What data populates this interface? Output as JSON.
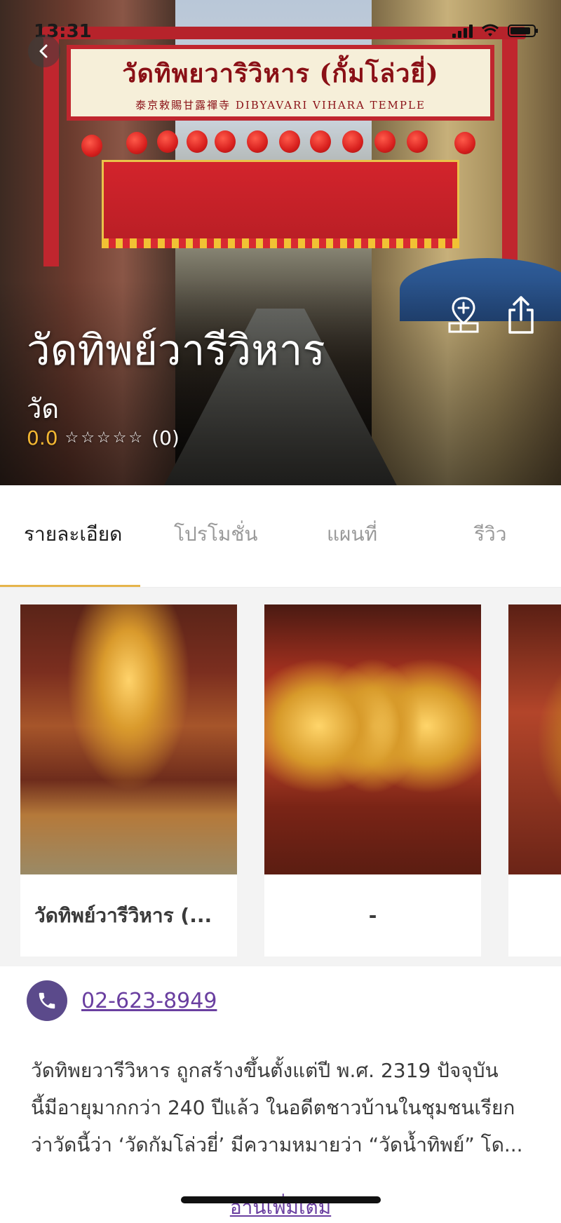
{
  "status_bar": {
    "time": "13:31"
  },
  "hero": {
    "sign_line1": "วัดทิพยวาริวิหาร (กั้มโล่วยี่)",
    "sign_line2": "泰京敕賜甘露禪寺  DIBYAVARI VIHARA TEMPLE",
    "title": "วัดทิพย์วารีวิหาร",
    "category": "วัด",
    "rating_score": "0.0",
    "stars": "☆☆☆☆☆",
    "rating_count": "(0)",
    "actions": [
      "add-to-list-icon",
      "share-icon"
    ]
  },
  "tabs": [
    {
      "label": "รายละเอียด",
      "active": true
    },
    {
      "label": "โปรโมชั่น",
      "active": false
    },
    {
      "label": "แผนที่",
      "active": false
    },
    {
      "label": "รีวิว",
      "active": false
    }
  ],
  "gallery": [
    {
      "caption": "วัดทิพย์วารีวิหาร (..."
    },
    {
      "caption": "-"
    },
    {
      "caption": ""
    }
  ],
  "contact": {
    "phone": "02-623-8949"
  },
  "description": {
    "lines": [
      "วัดทิพยวารีวิหาร ถูกสร้างขึ้นตั้งแต่ปี พ.ศ. 2319 ปัจจุบัน",
      "นี้มีอายุมากกว่า 240 ปีแล้ว ในอดีตชาวบ้านในชุมชนเรียก",
      "ว่าวัดนี้ว่า ‘วัดกัมโล่วยี่’ มีความหมายว่า “วัดน้ำทิพย์” โด..."
    ],
    "read_more": "อ่านเพิ่มเติม"
  },
  "colors": {
    "accent": "#e6b44b",
    "brand_purple": "#5b4a8b",
    "link": "#6a3fa0",
    "rating": "#f2b632"
  }
}
